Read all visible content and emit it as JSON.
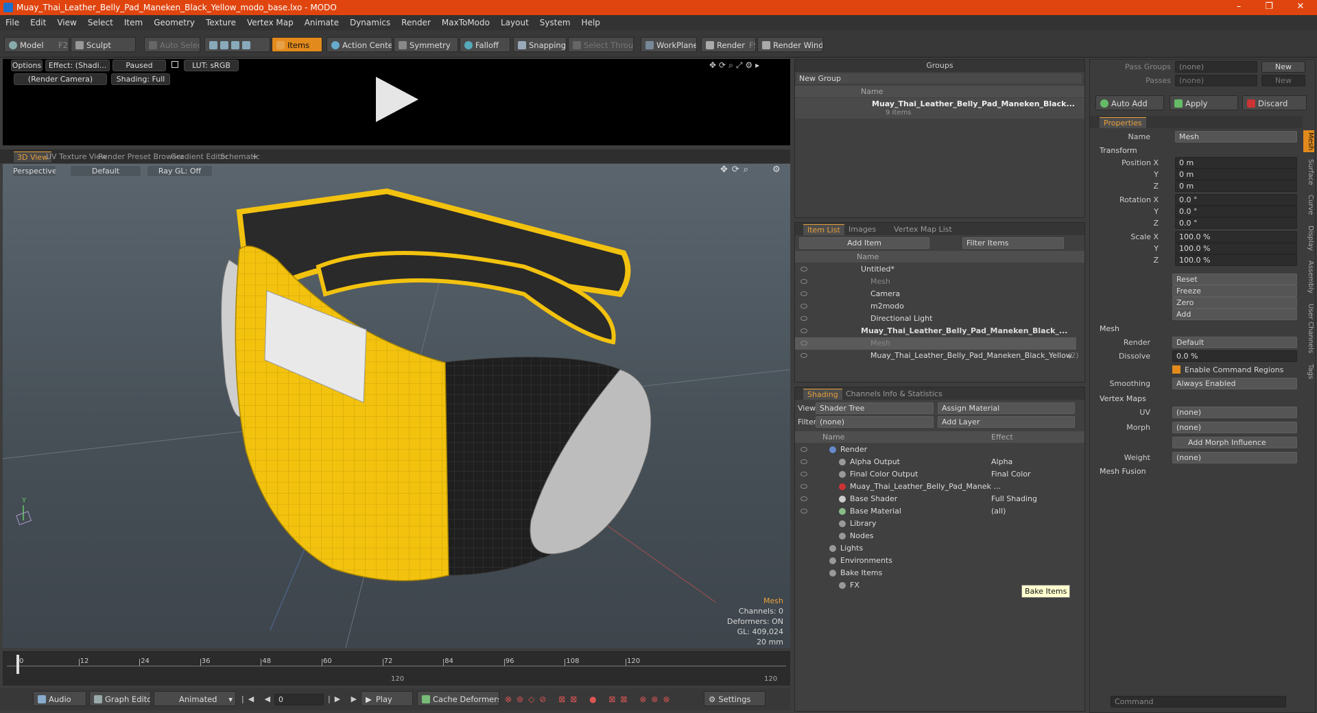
{
  "window": {
    "title": "Muay_Thai_Leather_Belly_Pad_Maneken_Black_Yellow_modo_base.lxo - MODO"
  },
  "menu": [
    "File",
    "Edit",
    "View",
    "Select",
    "Item",
    "Geometry",
    "Texture",
    "Vertex Map",
    "Animate",
    "Dynamics",
    "Render",
    "MaxToModo",
    "Layout",
    "System",
    "Help"
  ],
  "toolbar": {
    "model": "Model",
    "model_key": "F2",
    "sculpt": "Sculpt",
    "auto_select": "Auto Select",
    "items": "Items",
    "action_center": "Action Center",
    "symmetry": "Symmetry",
    "falloff": "Falloff",
    "snapping": "Snapping",
    "select_through": "Select Through",
    "workplane": "WorkPlane",
    "render": "Render",
    "render_key": "F9",
    "render_window": "Render Window"
  },
  "preview": {
    "options": "Options",
    "effect": "Effect: (Shadi...",
    "paused": "Paused",
    "lut": "LUT: sRGB",
    "camera": "(Render Camera)",
    "shading": "Shading: Full"
  },
  "vptabs": [
    "3D View",
    "UV Texture View",
    "Render Preset Browser",
    "Gradient Editor",
    "Schematic"
  ],
  "viewport": {
    "perspective": "Perspective",
    "default": "Default",
    "raygl": "Ray GL: Off",
    "info": {
      "title": "Mesh",
      "channels": "Channels: 0",
      "deformers": "Deformers: ON",
      "gl": "GL: 409,024",
      "unit": "20 mm"
    }
  },
  "timeline": {
    "ticks": [
      "0",
      "12",
      "24",
      "36",
      "48",
      "60",
      "72",
      "84",
      "96",
      "108",
      "120"
    ],
    "sub_mid": "120",
    "sub_end": "120"
  },
  "transport": {
    "audio": "Audio",
    "graph_editor": "Graph Editor",
    "animated": "Animated",
    "frame": "0",
    "play": "Play",
    "cache": "Cache Deformers",
    "settings": "Settings"
  },
  "groups": {
    "title": "Groups",
    "new_group": "New Group",
    "col_name": "Name",
    "item_name": "Muay_Thai_Leather_Belly_Pad_Maneken_Black...",
    "item_sub": "9 Items"
  },
  "itemlist": {
    "tabs": [
      "Item List",
      "Images",
      "Vertex Map List"
    ],
    "add_item": "Add Item",
    "filter": "Filter Items",
    "col_name": "Name",
    "rows": [
      {
        "label": "Untitled*",
        "indent": 0,
        "bold": false,
        "dim": false
      },
      {
        "label": "Mesh",
        "indent": 1,
        "bold": false,
        "dim": true
      },
      {
        "label": "Camera",
        "indent": 1,
        "bold": false,
        "dim": false
      },
      {
        "label": "m2modo",
        "indent": 1,
        "bold": false,
        "dim": false
      },
      {
        "label": "Directional Light",
        "indent": 1,
        "bold": false,
        "dim": false
      },
      {
        "label": "Muay_Thai_Leather_Belly_Pad_Maneken_Black_...",
        "indent": 0,
        "bold": true,
        "dim": false
      },
      {
        "label": "Mesh",
        "indent": 1,
        "bold": false,
        "dim": true,
        "sel": true
      },
      {
        "label": "Muay_Thai_Leather_Belly_Pad_Maneken_Black_Yellow",
        "indent": 1,
        "bold": false,
        "dim": false,
        "suffix": "(2)"
      }
    ]
  },
  "shading": {
    "tabs": [
      "Shading",
      "Channels",
      "Info & Statistics"
    ],
    "view_lbl": "View",
    "view_val": "Shader Tree",
    "assign": "Assign Material",
    "filter_lbl": "Filter",
    "filter_val": "(none)",
    "add_layer": "Add Layer",
    "col_name": "Name",
    "col_effect": "Effect",
    "rows": [
      {
        "label": "Render",
        "effect": "",
        "indent": 0
      },
      {
        "label": "Alpha Output",
        "effect": "Alpha",
        "indent": 1
      },
      {
        "label": "Final Color Output",
        "effect": "Final Color",
        "indent": 1
      },
      {
        "label": "Muay_Thai_Leather_Belly_Pad_Manek ...",
        "effect": "",
        "indent": 1
      },
      {
        "label": "Base Shader",
        "effect": "Full Shading",
        "indent": 1
      },
      {
        "label": "Base Material",
        "effect": "(all)",
        "indent": 1
      },
      {
        "label": "Library",
        "effect": "",
        "indent": 1
      },
      {
        "label": "Nodes",
        "effect": "",
        "indent": 1
      },
      {
        "label": "Lights",
        "effect": "",
        "indent": 0
      },
      {
        "label": "Environments",
        "effect": "",
        "indent": 0
      },
      {
        "label": "Bake Items",
        "effect": "",
        "indent": 0
      },
      {
        "label": "FX",
        "effect": "",
        "indent": 1
      }
    ],
    "tooltip": "Bake Items"
  },
  "passes": {
    "pass_groups": "Pass Groups",
    "passes": "Passes",
    "none": "(none)",
    "new": "New",
    "auto_add": "Auto Add",
    "apply": "Apply",
    "discard": "Discard"
  },
  "properties": {
    "tab": "Properties",
    "name_lbl": "Name",
    "name_val": "Mesh",
    "transform": "Transform",
    "pos": [
      {
        "lbl": "Position X",
        "val": "0 m"
      },
      {
        "lbl": "Y",
        "val": "0 m"
      },
      {
        "lbl": "Z",
        "val": "0 m"
      }
    ],
    "rot": [
      {
        "lbl": "Rotation X",
        "val": "0.0 °"
      },
      {
        "lbl": "Y",
        "val": "0.0 °"
      },
      {
        "lbl": "Z",
        "val": "0.0 °"
      }
    ],
    "scale": [
      {
        "lbl": "Scale X",
        "val": "100.0 %"
      },
      {
        "lbl": "Y",
        "val": "100.0 %"
      },
      {
        "lbl": "Z",
        "val": "100.0 %"
      }
    ],
    "actions": [
      "Reset",
      "Freeze",
      "Zero",
      "Add"
    ],
    "mesh": "Mesh",
    "render_lbl": "Render",
    "render_val": "Default",
    "dissolve_lbl": "Dissolve",
    "dissolve_val": "0.0 %",
    "enable_cmd": "Enable Command Regions",
    "smoothing_lbl": "Smoothing",
    "smoothing_val": "Always Enabled",
    "vertex_maps": "Vertex Maps",
    "uv_lbl": "UV",
    "uv_val": "(none)",
    "morph_lbl": "Morph",
    "morph_val": "(none)",
    "add_morph": "Add Morph Influence",
    "weight_lbl": "Weight",
    "weight_val": "(none)",
    "mesh_fusion": "Mesh Fusion"
  },
  "sidetabs": [
    "Mesh",
    "Surface",
    "Curve",
    "Display",
    "Assembly",
    "User Channels",
    "Tags"
  ],
  "command": {
    "placeholder": "Command"
  },
  "colors": {
    "accent": "#e28a1c",
    "title": "#e0450f",
    "yellow": "#f2c20f"
  }
}
